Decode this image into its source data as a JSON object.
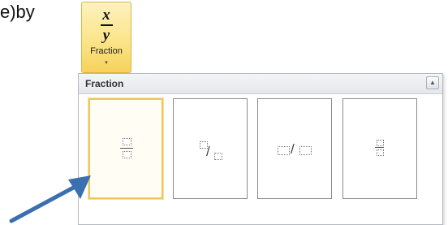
{
  "partial_text": "e)by",
  "ribbon_button": {
    "icon_numerator": "x",
    "icon_denominator": "y",
    "label": "Fraction",
    "chevron": "▾"
  },
  "gallery": {
    "title": "Fraction",
    "scroll_up": "▲",
    "tiles": [
      {
        "style": "stacked-fraction",
        "selected": true
      },
      {
        "style": "skewed-fraction",
        "selected": false
      },
      {
        "style": "linear-fraction",
        "selected": false
      },
      {
        "style": "small-stacked-fraction",
        "selected": false
      }
    ]
  },
  "colors": {
    "button_fill": "#fbe48a",
    "selected_border": "#f2c55c",
    "arrow": "#3a6fb0"
  }
}
